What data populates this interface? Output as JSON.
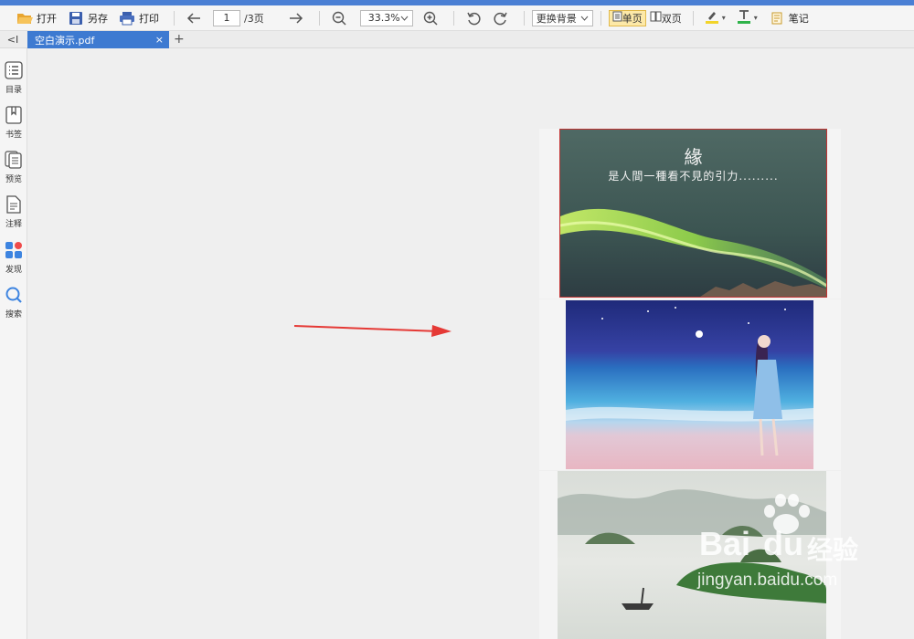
{
  "toolbar": {
    "open_label": "打开",
    "saveas_label": "另存",
    "print_label": "打印",
    "page_current": "1",
    "page_total": "/3页",
    "zoom_value": "33.3%",
    "background_label": "更换背景",
    "single_page_label": "单页",
    "double_page_label": "双页",
    "notes_label": "笔记"
  },
  "tabs": {
    "collapse": "<I",
    "doc_name": "空白演示.pdf",
    "close": "×",
    "add": "+"
  },
  "sidebar": {
    "items": [
      {
        "label": "目录",
        "icon": "list-icon"
      },
      {
        "label": "书签",
        "icon": "bookmark-icon"
      },
      {
        "label": "预览",
        "icon": "preview-icon"
      },
      {
        "label": "注释",
        "icon": "annotation-icon"
      },
      {
        "label": "发现",
        "icon": "discover-icon"
      },
      {
        "label": "搜索",
        "icon": "search-icon"
      }
    ]
  },
  "pages": [
    {
      "title": "緣",
      "subtitle": "是人間一種看不見的引力........."
    },
    {},
    {}
  ],
  "watermark": {
    "brand": "Bai",
    "brand_end": "du",
    "suffix": "经验",
    "url": "jingyan.baidu.com"
  },
  "colors": {
    "accent": "#3d7ad1",
    "active_view": "#fde9a8",
    "arrow": "#e53935"
  }
}
